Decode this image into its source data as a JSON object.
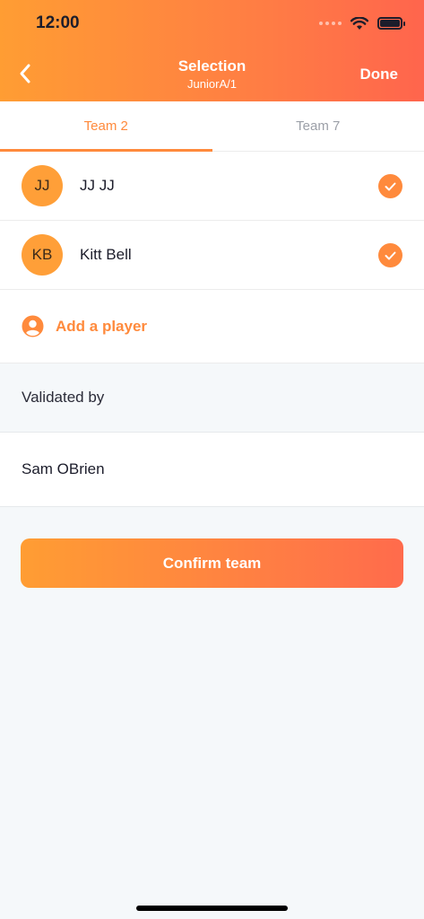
{
  "status_bar": {
    "time": "12:00"
  },
  "header": {
    "title": "Selection",
    "subtitle": "JuniorA/1",
    "done_label": "Done"
  },
  "tabs": [
    {
      "label": "Team 2",
      "active": true
    },
    {
      "label": "Team 7",
      "active": false
    }
  ],
  "players": [
    {
      "initials": "JJ",
      "name": "JJ JJ",
      "selected": true
    },
    {
      "initials": "KB",
      "name": "Kitt Bell",
      "selected": true
    }
  ],
  "add_player_label": "Add a player",
  "validation": {
    "section_label": "Validated by",
    "validator_name": "Sam OBrien"
  },
  "confirm_label": "Confirm team",
  "colors": {
    "accent": "#ff8a3c",
    "avatar": "#ff9f38",
    "gradient_start": "#ff9d33",
    "gradient_end": "#ff654d"
  }
}
